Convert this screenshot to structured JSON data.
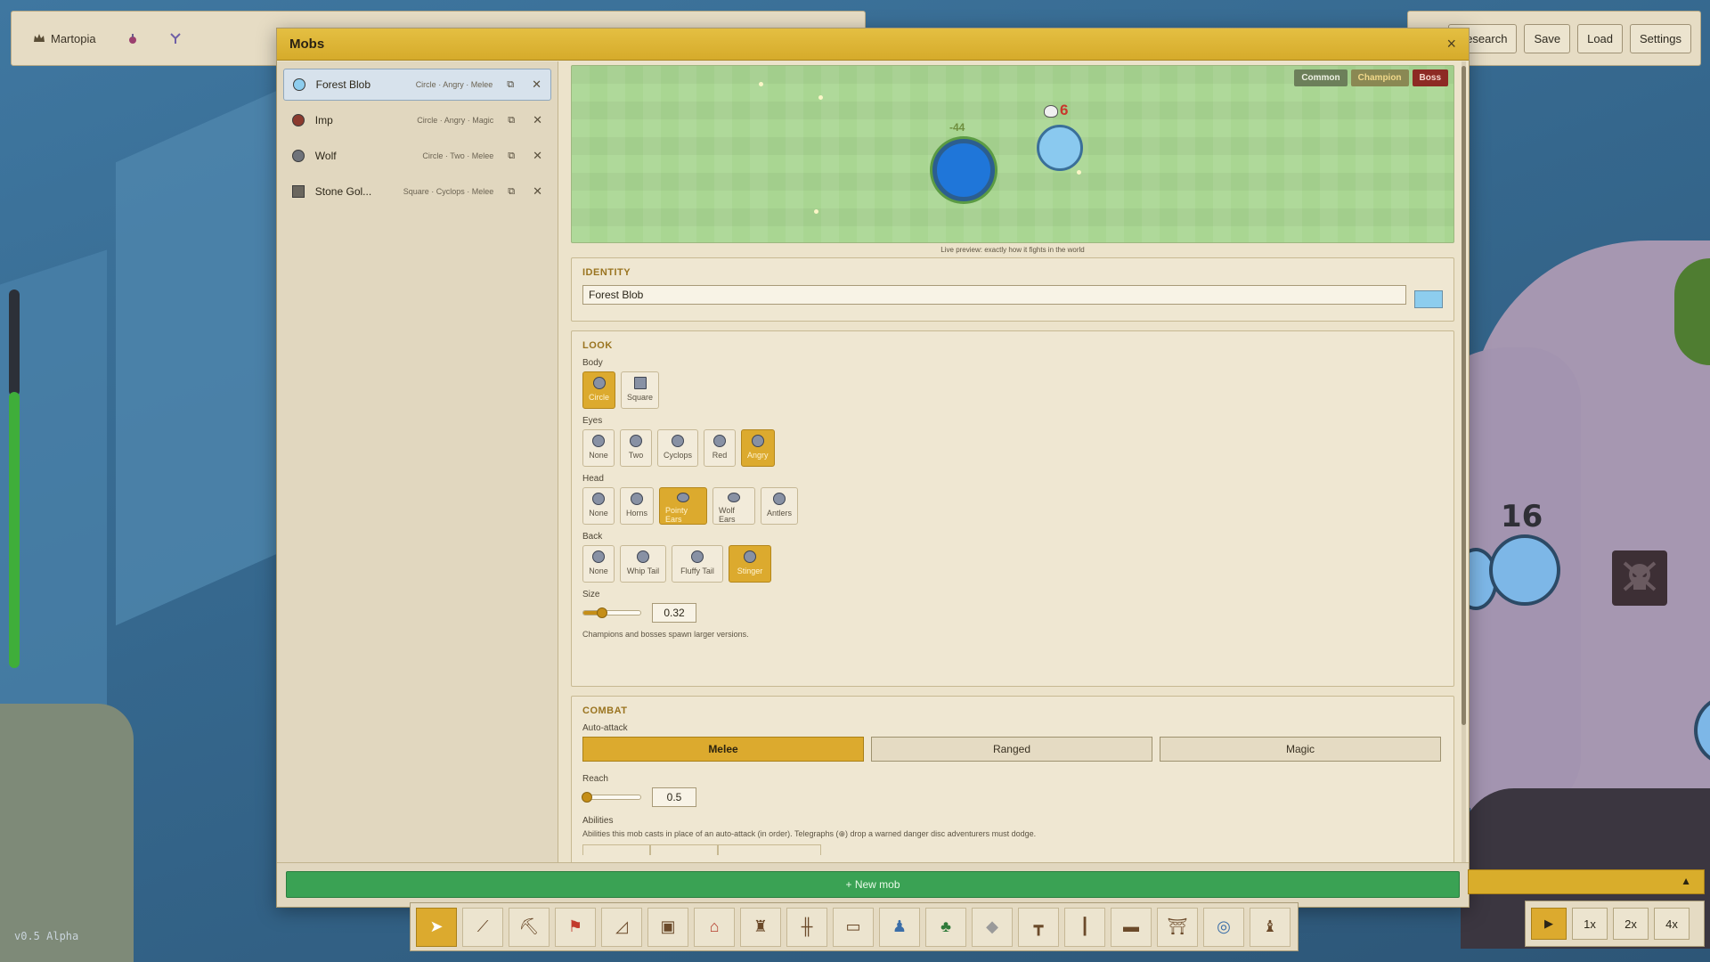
{
  "world": {
    "version": "v0.5 Alpha",
    "enemy_count": "16"
  },
  "topbar_left": {
    "settlement_name": "Martopia"
  },
  "topbar_right": {
    "buttons": [
      "Research",
      "Save",
      "Load",
      "Settings"
    ]
  },
  "mobs_window": {
    "title": "Mobs",
    "close_symbol": "×",
    "mobs": [
      {
        "name": "Forest Blob",
        "tags": "Circle · Angry · Melee",
        "color": "#8dcdee",
        "active": true
      },
      {
        "name": "Imp",
        "tags": "Circle · Angry · Magic",
        "color": "#8b3a2e",
        "active": false
      },
      {
        "name": "Wolf",
        "tags": "Circle · Two · Melee",
        "color": "#6f737a",
        "active": false
      },
      {
        "name": "Stone Gol...",
        "tags": "Square · Cyclops · Melee",
        "color": "#6a665e",
        "active": false
      }
    ],
    "preview": {
      "tiers": [
        "Common",
        "Champion",
        "Boss"
      ],
      "damage_number": "-44",
      "kill_count": "6",
      "caption": "Live preview: exactly how it fights in the world"
    },
    "identity": {
      "title": "IDENTITY",
      "name_value": "Forest Blob",
      "color": "#8dcdee"
    },
    "look": {
      "title": "LOOK",
      "body_label": "Body",
      "body_options": [
        "Circle",
        "Square"
      ],
      "body_selected": "Circle",
      "eyes_label": "Eyes",
      "eyes_options": [
        "None",
        "Two",
        "Cyclops",
        "Red",
        "Angry"
      ],
      "eyes_selected": "Angry",
      "head_label": "Head",
      "head_options": [
        "None",
        "Horns",
        "Pointy Ears",
        "Wolf Ears",
        "Antlers"
      ],
      "head_selected": "Pointy Ears",
      "back_label": "Back",
      "back_options": [
        "None",
        "Whip Tail",
        "Fluffy Tail",
        "Stinger"
      ],
      "back_selected": "Stinger",
      "size_label": "Size",
      "size_value": "0.32",
      "size_fraction": 0.32,
      "size_hint": "Champions and bosses spawn larger versions."
    },
    "combat": {
      "title": "COMBAT",
      "autoattack_label": "Auto-attack",
      "autoattack_options": [
        "Melee",
        "Ranged",
        "Magic"
      ],
      "autoattack_selected": "Melee",
      "reach_label": "Reach",
      "reach_value": "0.5",
      "abilities_label": "Abilities",
      "abilities_hint": "Abilities this mob casts in place of an auto-attack (in order). Telegraphs (⊕) drop a warned danger disc adventurers must dodge."
    },
    "new_mob_label": "+ New mob"
  },
  "speed": {
    "buttons": [
      "1x",
      "2x",
      "4x"
    ],
    "play_symbol": "▶",
    "collapse_symbol": "▲"
  }
}
